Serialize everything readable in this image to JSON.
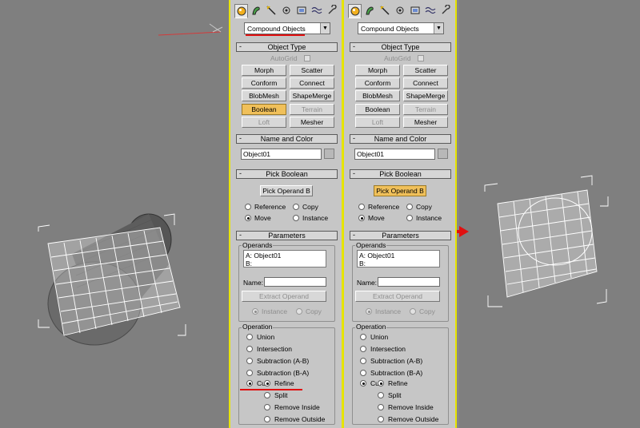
{
  "colors": {
    "viewport_bg": "#7f7f7f",
    "panel_bg": "#c6c6c6",
    "panel_border": "#e7e400",
    "active_button": "#f0c05a",
    "annotation_red": "#e01010",
    "wireframe": "#ffffff"
  },
  "tab_icons": [
    "create-sphere-icon",
    "modify-icon",
    "hierarchy-icon",
    "motion-icon",
    "display-icon",
    "utilities-icon",
    "wrench-icon"
  ],
  "panels": [
    {
      "category": "Compound Objects",
      "object_type": {
        "title": "Object Type",
        "autogrid": "AutoGrid",
        "buttons": [
          "Morph",
          "Scatter",
          "Conform",
          "Connect",
          "BlobMesh",
          "ShapeMerge",
          "Boolean",
          "Terrain",
          "Loft",
          "Mesher"
        ],
        "active": "Boolean",
        "disabled": [
          "Terrain",
          "Loft"
        ]
      },
      "name_and_color": {
        "title": "Name and Color",
        "name": "Object01"
      },
      "pick_boolean": {
        "title": "Pick Boolean",
        "button": "Pick Operand B",
        "button_active": false,
        "options": [
          "Reference",
          "Copy",
          "Move",
          "Instance"
        ],
        "selected": "Move"
      },
      "parameters": {
        "title": "Parameters",
        "operands_label": "Operands",
        "operands": [
          "A: Object01",
          "B:"
        ],
        "name_label": "Name:",
        "name_value": "",
        "extract_button": "Extract Operand",
        "extract_options": [
          "Instance",
          "Copy"
        ],
        "extract_selected": "Instance",
        "operation_label": "Operation",
        "operations": [
          "Union",
          "Intersection",
          "Subtraction (A-B)",
          "Subtraction (B-A)"
        ],
        "cut_label": "Cut",
        "cut_selected": true,
        "cut_options": [
          "Refine",
          "Split",
          "Remove Inside",
          "Remove Outside"
        ],
        "cut_option_selected": "Refine"
      }
    },
    {
      "category": "Compound Objects",
      "object_type": {
        "title": "Object Type",
        "autogrid": "AutoGrid",
        "buttons": [
          "Morph",
          "Scatter",
          "Conform",
          "Connect",
          "BlobMesh",
          "ShapeMerge",
          "Boolean",
          "Terrain",
          "Loft",
          "Mesher"
        ],
        "active": "",
        "disabled": [
          "Terrain",
          "Loft"
        ]
      },
      "name_and_color": {
        "title": "Name and Color",
        "name": "Object01"
      },
      "pick_boolean": {
        "title": "Pick Boolean",
        "button": "Pick Operand B",
        "button_active": true,
        "options": [
          "Reference",
          "Copy",
          "Move",
          "Instance"
        ],
        "selected": "Move"
      },
      "parameters": {
        "title": "Parameters",
        "operands_label": "Operands",
        "operands": [
          "A: Object01",
          "B:"
        ],
        "name_label": "Name:",
        "name_value": "",
        "extract_button": "Extract Operand",
        "extract_options": [
          "Instance",
          "Copy"
        ],
        "extract_selected": "Instance",
        "operation_label": "Operation",
        "operations": [
          "Union",
          "Intersection",
          "Subtraction (A-B)",
          "Subtraction (B-A)"
        ],
        "cut_label": "Cut",
        "cut_selected": true,
        "cut_options": [
          "Refine",
          "Split",
          "Remove Inside",
          "Remove Outside"
        ],
        "cut_option_selected": "Refine"
      }
    }
  ]
}
